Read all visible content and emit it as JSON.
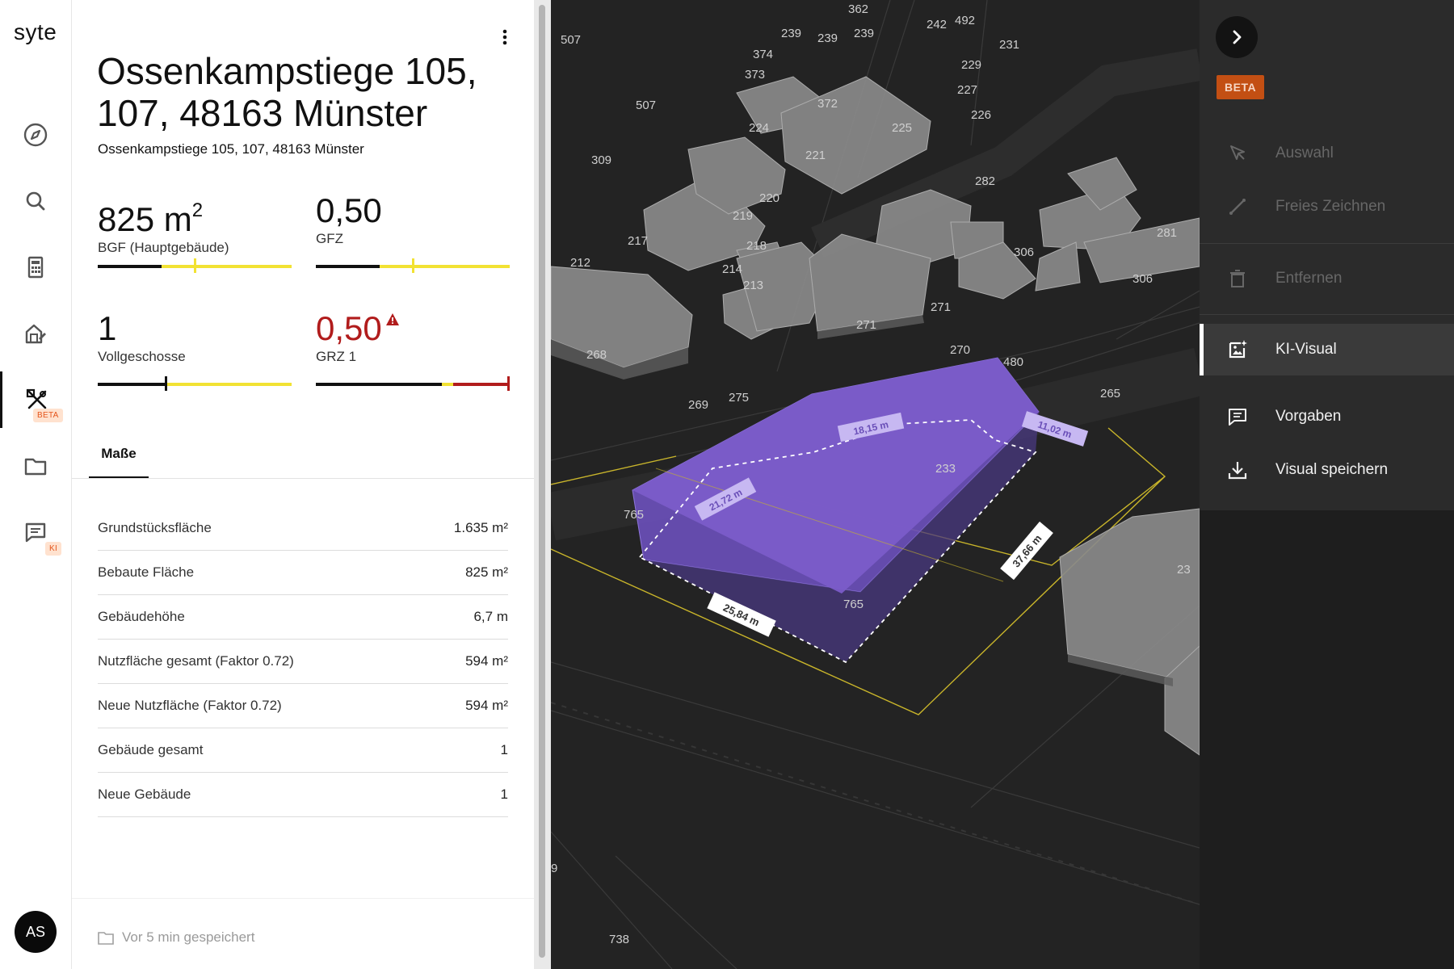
{
  "app": {
    "logo": "syte",
    "user_initials": "AS"
  },
  "rail": {
    "items": [
      {
        "icon": "compass-icon",
        "label": "Explore"
      },
      {
        "icon": "search-icon",
        "label": "Search"
      },
      {
        "icon": "calculator-icon",
        "label": "Calculator"
      },
      {
        "icon": "building-edit-icon",
        "label": "Building"
      },
      {
        "icon": "design-tools-icon",
        "label": "Design",
        "badge": "BETA",
        "active": true
      },
      {
        "icon": "folder-icon",
        "label": "Projects"
      },
      {
        "icon": "chat-icon",
        "label": "Assistant",
        "badge": "KI"
      }
    ]
  },
  "property": {
    "title": "Ossenkampstiege 105, 107, 48163 Münster",
    "subtitle": "Ossenkampstiege 105, 107, 48163 Münster"
  },
  "metrics": [
    {
      "value": "825 m",
      "sup": "2",
      "label": "BGF (Hauptgebäude)",
      "fill": 0.33,
      "marker": 0.5,
      "warn": false
    },
    {
      "value": "0,50",
      "label": "GFZ",
      "fill": 0.33,
      "marker": 0.5,
      "warn": false
    },
    {
      "value": "1",
      "label": "Vollgeschosse",
      "fill": 0.35,
      "marker": 0.35,
      "warn": false
    },
    {
      "value": "0,50",
      "label": "GRZ 1",
      "fill": 0.65,
      "marker": 1.0,
      "warn": true
    }
  ],
  "tabs": {
    "active": "Maße"
  },
  "measurements": [
    {
      "label": "Grundstücksfläche",
      "value": "1.635 m²"
    },
    {
      "label": "Bebaute Fläche",
      "value": "825 m²"
    },
    {
      "label": "Gebäudehöhe",
      "value": "6,7 m"
    },
    {
      "label": "Nutzfläche gesamt (Faktor 0.72)",
      "value": "594 m²"
    },
    {
      "label": "Neue Nutzfläche (Faktor 0.72)",
      "value": "594 m²"
    },
    {
      "label": "Gebäude gesamt",
      "value": "1"
    },
    {
      "label": "Neue Gebäude",
      "value": "1"
    }
  ],
  "footer": {
    "saved_text": "Vor 5 min gespeichert"
  },
  "map": {
    "plot_numbers": [
      "362",
      "507",
      "239",
      "239",
      "239",
      "242",
      "492",
      "231",
      "374",
      "373",
      "372",
      "229",
      "227",
      "226",
      "224",
      "225",
      "507",
      "221",
      "282",
      "309",
      "220",
      "219",
      "217",
      "218",
      "306",
      "281",
      "306",
      "212",
      "214",
      "213",
      "271",
      "271",
      "268",
      "270",
      "480",
      "269",
      "275",
      "265",
      "233",
      "765",
      "765",
      "23",
      "9",
      "738"
    ],
    "dimensions": [
      "18,15 m",
      "11,02 m",
      "21,72 m",
      "37,66 m",
      "25,84 m"
    ]
  },
  "tools": {
    "beta": "BETA",
    "items": [
      {
        "label": "Auswahl",
        "state": "disabled",
        "icon": "cursor-icon"
      },
      {
        "label": "Freies Zeichnen",
        "state": "disabled",
        "icon": "line-draw-icon"
      },
      {
        "label": "Entfernen",
        "state": "disabled",
        "icon": "trash-icon"
      },
      {
        "label": "KI-Visual",
        "state": "selected",
        "icon": "ai-image-icon"
      },
      {
        "label": "Vorgaben",
        "state": "enabled",
        "icon": "comment-icon"
      },
      {
        "label": "Visual speichern",
        "state": "enabled",
        "icon": "download-icon"
      }
    ]
  },
  "colors": {
    "accent_yellow": "#f2e233",
    "warn_red": "#b11c1c",
    "building_purple": "#7b5cc9",
    "beta_orange": "#c34f13"
  }
}
